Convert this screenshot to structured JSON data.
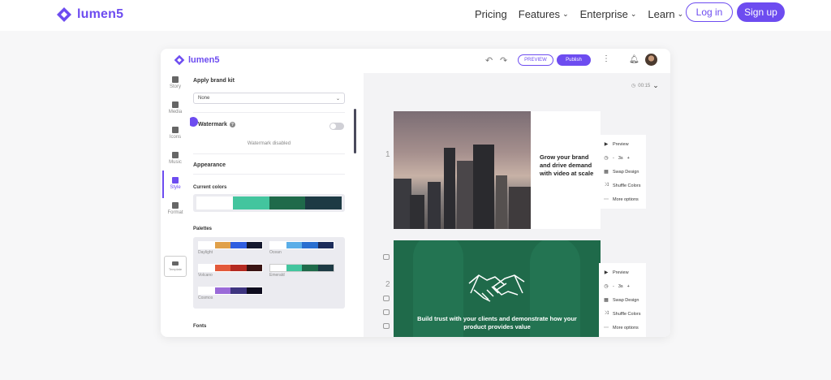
{
  "site": {
    "brand": "lumen5",
    "nav": [
      "Pricing",
      "Features",
      "Enterprise",
      "Learn"
    ],
    "login_label": "Log in",
    "signup_label": "Sign up",
    "accent": "#6d4cf0"
  },
  "app": {
    "brand": "lumen5",
    "preview_label": "PREVIEW",
    "publish_label": "Publish",
    "duration": "00:15",
    "rail": [
      "Story",
      "Media",
      "Icons",
      "Music",
      "Style",
      "Format",
      "Template"
    ],
    "panel": {
      "brand_kit_title": "Apply brand kit",
      "brand_kit_value": "None",
      "watermark_label": "Watermark",
      "watermark_status": "Watermark disabled",
      "appearance_label": "Appearance",
      "current_colors_label": "Current colors",
      "current_colors": [
        "#ffffff",
        "#43c59e",
        "#1f6a4a",
        "#1d3a44"
      ],
      "palettes_label": "Palettes",
      "palettes": [
        {
          "name": "Daylight",
          "colors": [
            "#ffffff",
            "#e0a04a",
            "#2f5ee0",
            "#14182e"
          ]
        },
        {
          "name": "Ocean",
          "colors": [
            "#ffffff",
            "#5aaee8",
            "#2a6fd0",
            "#1c2c5a"
          ]
        },
        {
          "name": "Volcano",
          "colors": [
            "#ffffff",
            "#e35a3b",
            "#b52b22",
            "#3a1414"
          ]
        },
        {
          "name": "Emerald",
          "colors": [
            "#ffffff",
            "#43c59e",
            "#1f6a4a",
            "#1d3a44"
          ]
        },
        {
          "name": "Cosmos",
          "colors": [
            "#ffffff",
            "#9a6ad8",
            "#3e3580",
            "#0e0c1e"
          ]
        }
      ],
      "fonts_label": "Fonts"
    },
    "scenes": [
      {
        "number": "1",
        "text": "Grow your brand and drive demand with video at scale"
      },
      {
        "number": "2",
        "text": "Build trust with your clients and demonstrate how your product provides value"
      }
    ],
    "scene_menu": {
      "preview": "Preview",
      "speed": "3s",
      "swap": "Swap Design",
      "shuffle": "Shuffle Colors",
      "more": "More options"
    }
  }
}
